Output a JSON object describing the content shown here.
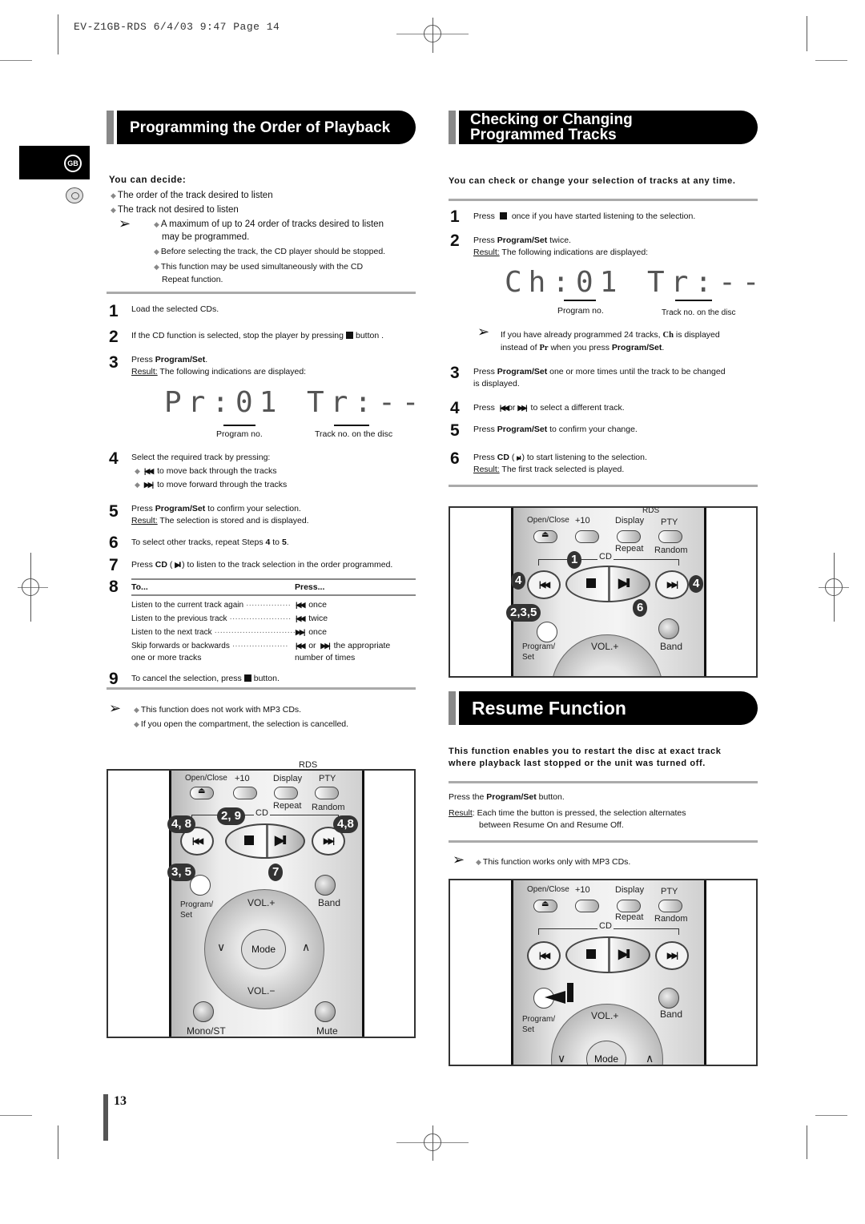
{
  "slug": "EV-Z1GB-RDS   6/4/03 9:47   Page 14",
  "language_tab": "GB",
  "page_number": "13",
  "left": {
    "title": "Programming the Order of Playback",
    "you_can_decide": "You can decide:",
    "decide_items": [
      "The order of the track desired to listen",
      "The track not desired to listen"
    ],
    "notes": [
      [
        "A maximum of up to 24 order of tracks desired to listen",
        "may be programmed."
      ],
      [
        "Before selecting the track, the CD player should be stopped."
      ],
      [
        "This function may be used simultaneously with the CD",
        "Repeat function."
      ]
    ],
    "steps": {
      "s1": {
        "num": "1",
        "text": "Load the selected CDs."
      },
      "s2": {
        "num": "2",
        "text_a": "If the CD function is selected, stop the player by pressing",
        "text_b": "button ."
      },
      "s3": {
        "num": "3",
        "press": "Press ",
        "bold": "Program/Set",
        "end": ".",
        "result_label": "Result:",
        "result": " The following indications are displayed:"
      },
      "s4": {
        "num": "4",
        "text": "Select the required track by pressing:",
        "back": "to move back through the tracks",
        "fwd": "to move forward through the tracks"
      },
      "s5": {
        "num": "5",
        "press": "Press ",
        "bold": "Program/Set",
        "rest": " to confirm your selection.",
        "result_label": "Result:",
        "result": " The selection is stored and is displayed."
      },
      "s6": {
        "num": "6",
        "text_a": "To select other tracks, repeat Steps ",
        "b1": "4",
        "mid": " to ",
        "b2": "5",
        "end": "."
      },
      "s7": {
        "num": "7",
        "press": "Press ",
        "bold": "CD",
        "rest_a": " ( ",
        "rest_b": " ) to listen to the track selection in the order programmed."
      },
      "s8": {
        "num": "8"
      },
      "s9": {
        "num": "9",
        "text_a": "To cancel the selection, press",
        "text_b": "button."
      }
    },
    "display": {
      "text": "Pr:01 Tr:--",
      "program_label": "Program no.",
      "track_label": "Track no. on the disc"
    },
    "table": {
      "col_to": "To...",
      "col_press": "Press...",
      "rows": [
        {
          "to": "Listen to the current track again",
          "press": "once",
          "icon": "prev"
        },
        {
          "to": "Listen to the previous track",
          "press": "twice",
          "icon": "prev"
        },
        {
          "to": "Listen to the next track",
          "press": "once",
          "icon": "next"
        },
        {
          "to": "Skip forwards or backwards",
          "press": "the appropriate",
          "icon": "both",
          "or": "or",
          "to2": "one or more tracks",
          "press2": "number of times"
        }
      ]
    },
    "footer_notes": [
      "This function does not work with MP3 CDs.",
      "If you open the compartment, the selection is cancelled."
    ]
  },
  "right": {
    "title_line1": "Checking or Changing",
    "title_line2": "Programmed Tracks",
    "intro": "You can check or change your selection of tracks at any time.",
    "steps": {
      "s1": {
        "num": "1",
        "text_a": "Press",
        "text_b": "once if you have started listening to the selection."
      },
      "s2": {
        "num": "2",
        "press": "Press ",
        "bold": "Program/Set",
        "rest": " twice.",
        "result_label": "Result:",
        "result": " The following indications are displayed:"
      },
      "s3": {
        "num": "3",
        "press": "Press ",
        "bold": "Program/Set",
        "rest": " one or more times until the track to be changed",
        "line2": "is displayed."
      },
      "s4": {
        "num": "4",
        "press": "Press",
        "or": "or",
        "rest": "to select a different track."
      },
      "s5": {
        "num": "5",
        "press": "Press ",
        "bold": "Program/Set",
        "rest": " to confirm your change."
      },
      "s6": {
        "num": "6",
        "press": "Press ",
        "bold": "CD",
        "rest_a": " ( ",
        "rest_b": " ) to start listening to the selection.",
        "result_label": "Result:",
        "result": " The first track selected is played."
      }
    },
    "display": {
      "text": "Ch:01 Tr:--",
      "program_label": "Program no.",
      "track_label": "Track no. on the disc"
    },
    "note": {
      "a": "If you have already programmed 24 tracks, ",
      "ch": "Ch",
      "b": " is displayed",
      "c": "instead of ",
      "pr": "Pr",
      "d": " when you press ",
      "bold": "Program/Set",
      "e": "."
    }
  },
  "resume": {
    "title": "Resume Function",
    "intro_line1": "This function enables you to restart the disc at exact track",
    "intro_line2": "where playback last stopped or the unit was turned off.",
    "press_a": "Press the ",
    "press_bold": "Program/Set",
    "press_b": " button.",
    "result_label": "Result",
    "result_line1": ": Each time the button is pressed, the selection alternates",
    "result_line2": "between Resume On and Resume Off.",
    "note": "This function works only with MP3 CDs."
  },
  "remote": {
    "open_close": "Open/Close",
    "plus10": "+10",
    "display": "Display",
    "pty": "PTY",
    "rds": "RDS",
    "repeat": "Repeat",
    "random": "Random",
    "cd": "CD",
    "program_set_1": "Program/",
    "program_set_2": "Set",
    "band": "Band",
    "vol_plus": "VOL.+",
    "vol_minus": "VOL.−",
    "mode": "Mode",
    "mono_st": "Mono/ST",
    "mute": "Mute",
    "down": "∨",
    "up": "∧"
  },
  "callouts_left": {
    "prev": "4, 8",
    "stop": "2, 9",
    "next": "4,8",
    "prog": "3, 5",
    "play": "7"
  },
  "callouts_right": {
    "stop": "1",
    "prev": "4",
    "next": "4",
    "prog": "2,3,5",
    "play": "6"
  }
}
